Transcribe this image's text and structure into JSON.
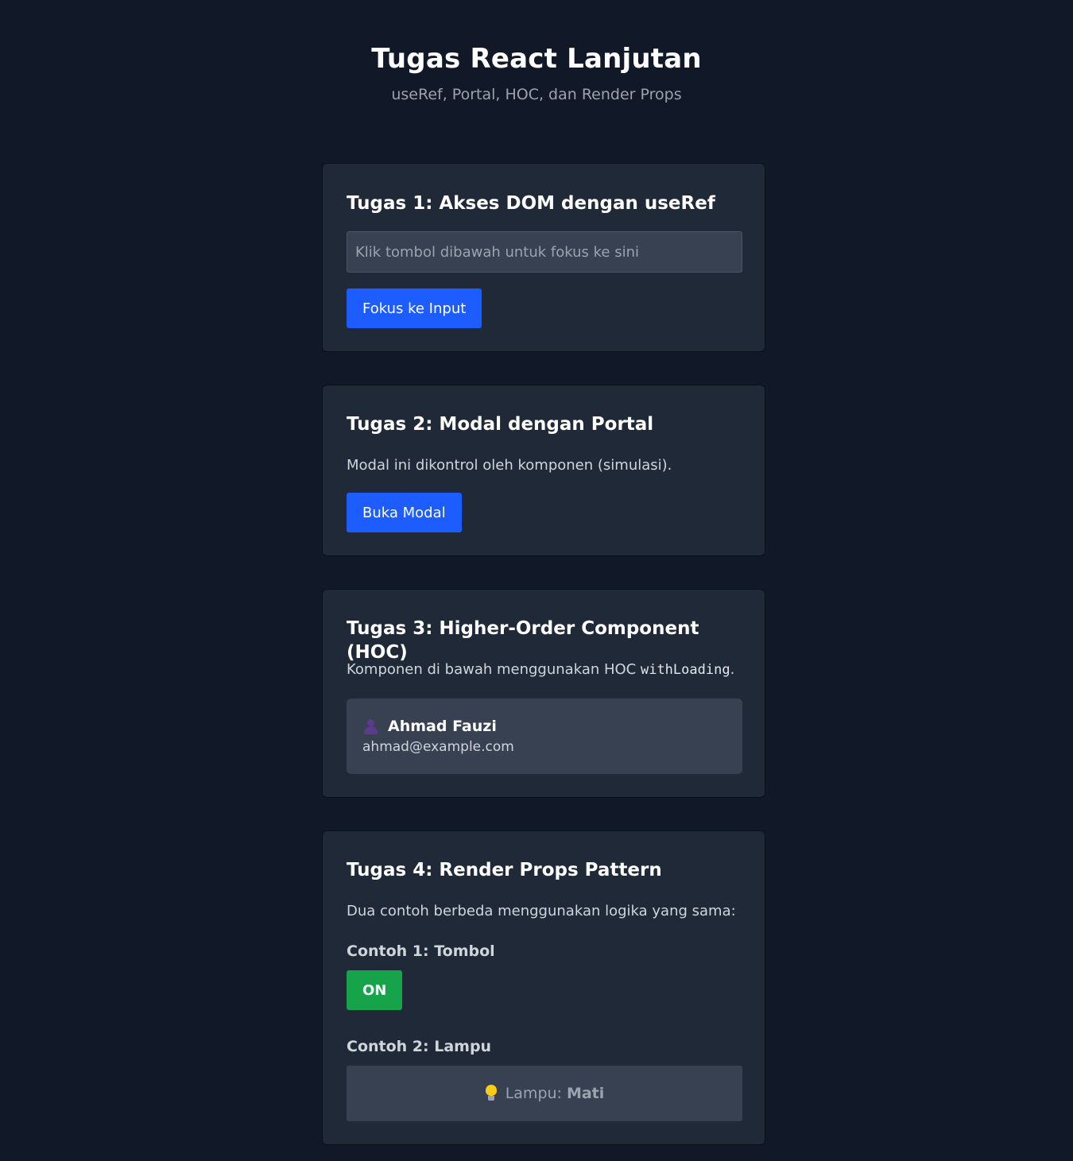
{
  "header": {
    "title": "Tugas React Lanjutan",
    "subtitle": "useRef, Portal, HOC, dan Render Props"
  },
  "task1": {
    "title": "Tugas 1: Akses DOM dengan useRef",
    "input_placeholder": "Klik tombol dibawah untuk fokus ke sini",
    "input_value": "",
    "button_label": "Fokus ke Input"
  },
  "task2": {
    "title": "Tugas 2: Modal dengan Portal",
    "description": "Modal ini dikontrol oleh komponen (simulasi).",
    "button_label": "Buka Modal"
  },
  "task3": {
    "title": "Tugas 3: Higher-Order Component (HOC)",
    "description_prefix": "Komponen di bawah menggunakan HOC ",
    "description_code": "withLoading",
    "description_suffix": ".",
    "user": {
      "icon": "user-icon",
      "name": "Ahmad Fauzi",
      "email": "ahmad@example.com"
    }
  },
  "task4": {
    "title": "Tugas 4: Render Props Pattern",
    "description": "Dua contoh berbeda menggunakan logika yang sama:",
    "example1_label": "Contoh 1: Tombol",
    "toggle_label": "ON",
    "example2_label": "Contoh 2: Lampu",
    "lamp_icon": "lightbulb-icon",
    "lamp_label": "Lampu:",
    "lamp_state": "Mati"
  },
  "colors": {
    "background": "#111827",
    "card": "#1f2937",
    "primary_button": "#1d5cff",
    "toggle_on": "#16a34a",
    "bulb": "#facc15"
  }
}
